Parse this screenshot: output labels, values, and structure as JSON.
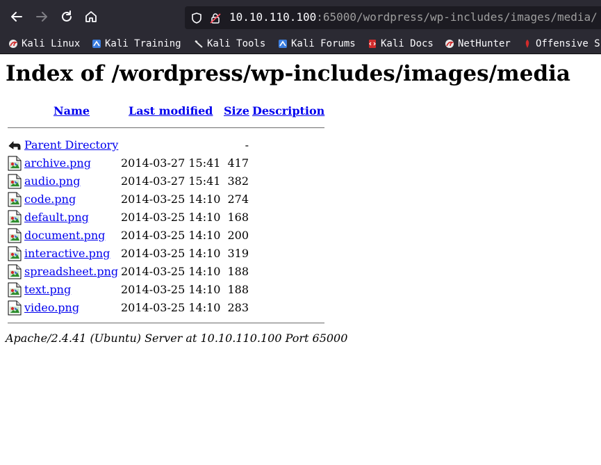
{
  "browser": {
    "url_host": "10.10.110.100",
    "url_rest": ":65000/wordpress/wp-includes/images/media/",
    "bookmarks": [
      {
        "label": "Kali Linux",
        "icon": "kali-dragon-icon"
      },
      {
        "label": "Kali Training",
        "icon": "kali-training-icon"
      },
      {
        "label": "Kali Tools",
        "icon": "kali-tools-icon"
      },
      {
        "label": "Kali Forums",
        "icon": "kali-forums-icon"
      },
      {
        "label": "Kali Docs",
        "icon": "kali-docs-icon"
      },
      {
        "label": "NetHunter",
        "icon": "nethunter-icon"
      },
      {
        "label": "Offensive S",
        "icon": "offensive-security-icon"
      }
    ]
  },
  "page": {
    "title": "Index of /wordpress/wp-includes/images/media",
    "columns": {
      "name": "Name",
      "last_modified": "Last modified",
      "size": "Size",
      "description": "Description"
    },
    "parent": {
      "name": "Parent Directory",
      "size": "-"
    },
    "files": [
      {
        "name": "archive.png",
        "modified": "2014-03-27 15:41",
        "size": "417"
      },
      {
        "name": "audio.png",
        "modified": "2014-03-27 15:41",
        "size": "382"
      },
      {
        "name": "code.png",
        "modified": "2014-03-25 14:10",
        "size": "274"
      },
      {
        "name": "default.png",
        "modified": "2014-03-25 14:10",
        "size": "168"
      },
      {
        "name": "document.png",
        "modified": "2014-03-25 14:10",
        "size": "200"
      },
      {
        "name": "interactive.png",
        "modified": "2014-03-25 14:10",
        "size": "319"
      },
      {
        "name": "spreadsheet.png",
        "modified": "2014-03-25 14:10",
        "size": "188"
      },
      {
        "name": "text.png",
        "modified": "2014-03-25 14:10",
        "size": "188"
      },
      {
        "name": "video.png",
        "modified": "2014-03-25 14:10",
        "size": "283"
      }
    ],
    "address": "Apache/2.4.41 (Ubuntu) Server at 10.10.110.100 Port 65000"
  },
  "colors": {
    "toolbar_bg": "#2b2a33",
    "link": "#0000ee"
  }
}
